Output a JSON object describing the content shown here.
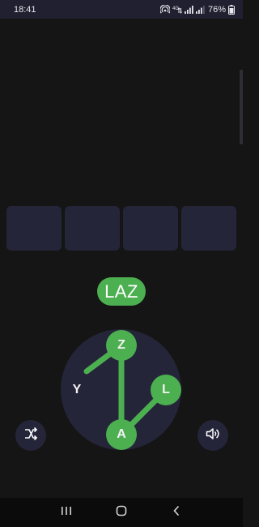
{
  "status_bar": {
    "time": "18:41",
    "battery_percent": "76%",
    "network_label": "4G",
    "icons": [
      "hotspot-icon",
      "network-4g-icon",
      "signal-icon",
      "signal-icon",
      "battery-icon"
    ]
  },
  "answer_slots": {
    "count": 4
  },
  "current_word": "LAZ",
  "wheel": {
    "letters": [
      {
        "char": "Z",
        "selected": true
      },
      {
        "char": "L",
        "selected": true
      },
      {
        "char": "A",
        "selected": true
      },
      {
        "char": "Y",
        "selected": false
      }
    ],
    "selection_path": [
      "Y",
      "Z",
      "A",
      "L"
    ]
  },
  "controls": {
    "shuffle_icon": "shuffle-icon",
    "sound_icon": "volume-icon"
  },
  "nav": {
    "buttons": [
      "recents-icon",
      "home-icon",
      "back-icon"
    ]
  },
  "colors": {
    "background": "#151515",
    "panel": "#25253a",
    "accent": "#4caf50",
    "status_bar": "#202030",
    "nav_bar": "#0b0b0b"
  }
}
